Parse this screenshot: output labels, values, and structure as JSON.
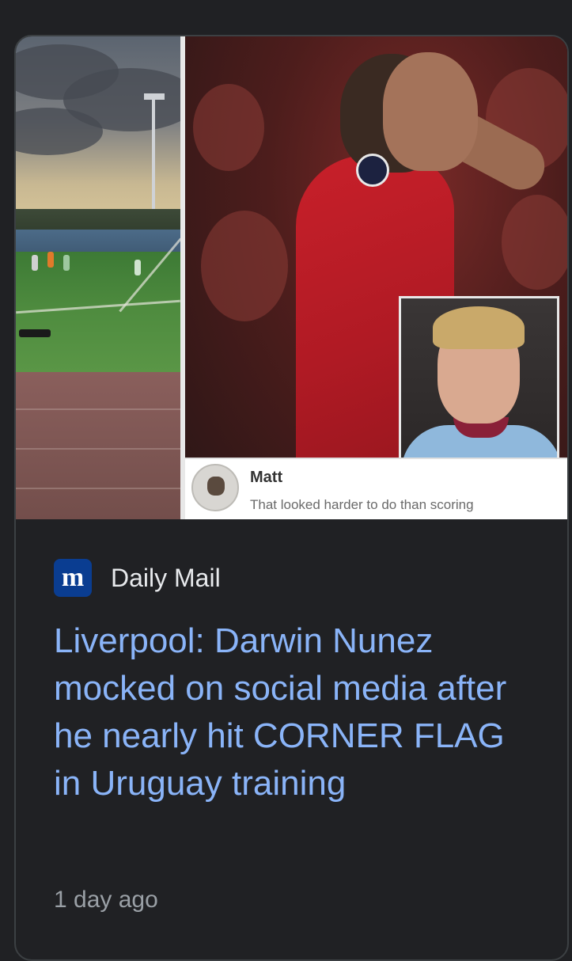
{
  "article": {
    "thumbnail": {
      "comment_author": "Matt",
      "comment_text": "That looked harder to do than scoring"
    },
    "source_logo": "m",
    "source_name": "Daily Mail",
    "headline": "Liverpool: Darwin Nunez mocked on social media after he nearly hit CORNER FLAG in Uruguay training",
    "timestamp": "1 day ago"
  },
  "colors": {
    "background": "#202124",
    "headline": "#8ab4f8",
    "source_text": "#e8eaed",
    "timestamp": "#9aa0a6",
    "logo_bg": "#0a3d91"
  }
}
